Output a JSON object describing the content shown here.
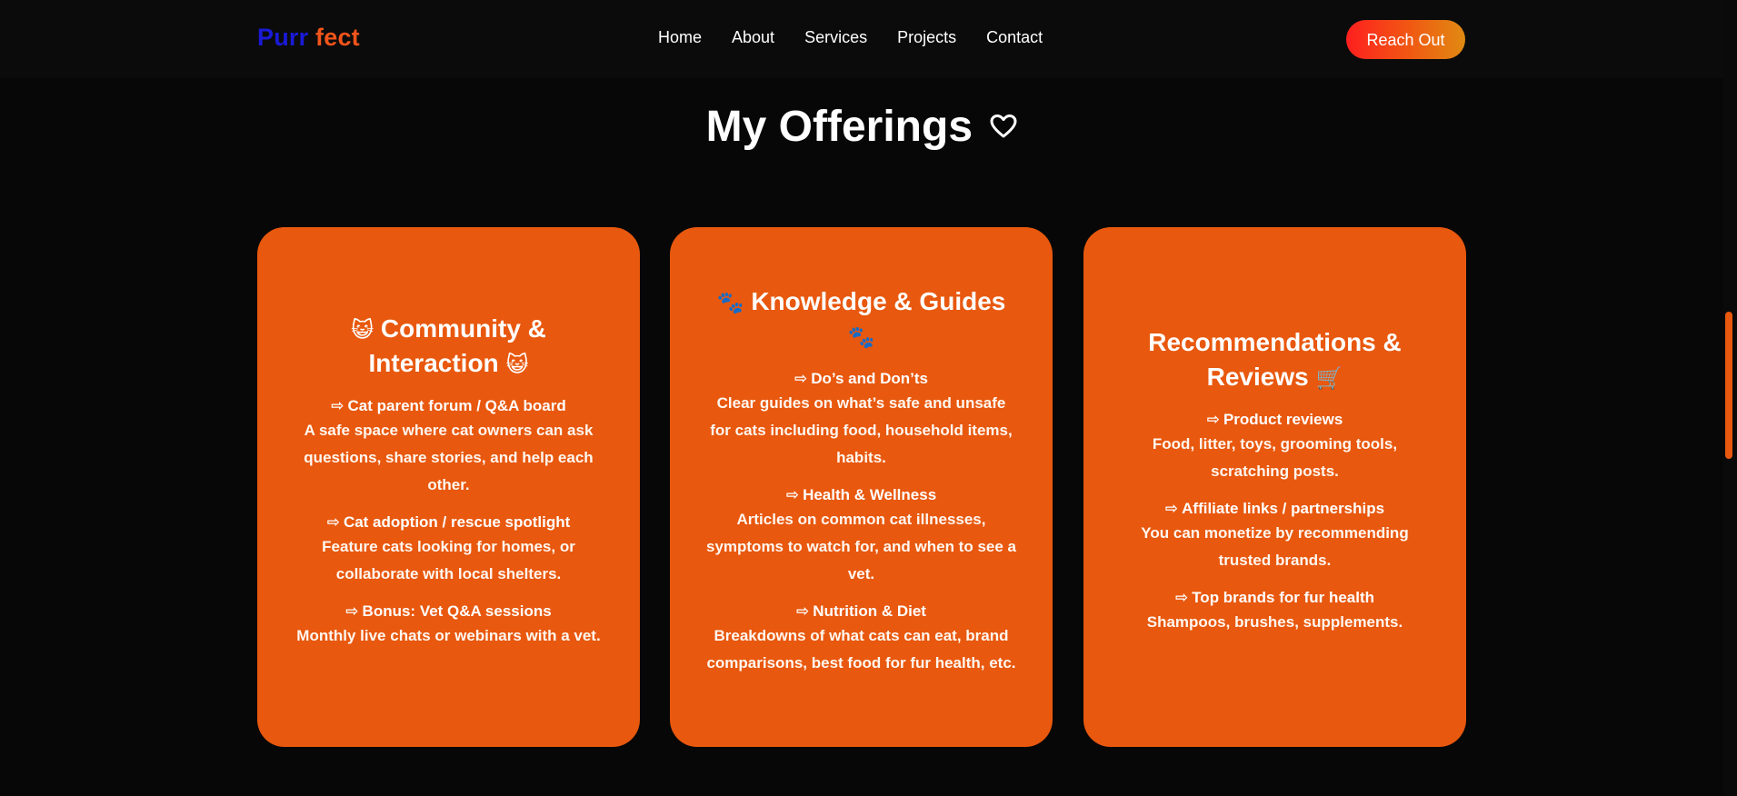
{
  "header": {
    "logo_part1": "Purr",
    "logo_part2": "fect",
    "nav": [
      "Home",
      "About",
      "Services",
      "Projects",
      "Contact"
    ],
    "cta_label": "Reach Out"
  },
  "section": {
    "title": "My Offerings",
    "title_icon": "♡"
  },
  "cards": [
    {
      "title": "Community & Interaction",
      "title_emoji": "😺",
      "items": [
        {
          "title": "Cat parent forum / Q&A board",
          "desc": "A safe space where cat owners can ask questions, share stories, and help each other."
        },
        {
          "title": "Cat adoption / rescue spotlight",
          "desc": "Feature cats looking for homes, or collaborate with local shelters."
        },
        {
          "title": "Bonus: Vet Q&A sessions",
          "desc": "Monthly live chats or webinars with a vet."
        }
      ]
    },
    {
      "title": "Knowledge & Guides",
      "title_emoji": "🐾",
      "items": [
        {
          "title": "Do’s and Don’ts",
          "desc": "Clear guides on what’s safe and unsafe for cats including food, household items, habits."
        },
        {
          "title": "Health & Wellness",
          "desc": "Articles on common cat illnesses, symptoms to watch for, and when to see a vet."
        },
        {
          "title": "Nutrition & Diet",
          "desc": "Breakdowns of what cats can eat, brand comparisons, best food for fur health, etc."
        }
      ]
    },
    {
      "title": "Recommendations & Reviews",
      "title_emoji": "🛒",
      "items": [
        {
          "title": "Product reviews",
          "desc": "Food, litter, toys, grooming tools, scratching posts."
        },
        {
          "title": "Affiliate links / partnerships",
          "desc": "You can monetize by recommending trusted brands."
        },
        {
          "title": "Top brands for fur health",
          "desc": "Shampoos, brushes, supplements."
        }
      ]
    }
  ],
  "arrow_glyph": "⇨",
  "colors": {
    "background": "#070707",
    "card": "#e8580e",
    "logo_blue": "#1a1ad6",
    "logo_orange": "#f2541b",
    "cta_gradient_start": "#ff1f1f",
    "cta_gradient_end": "#e08a12"
  }
}
